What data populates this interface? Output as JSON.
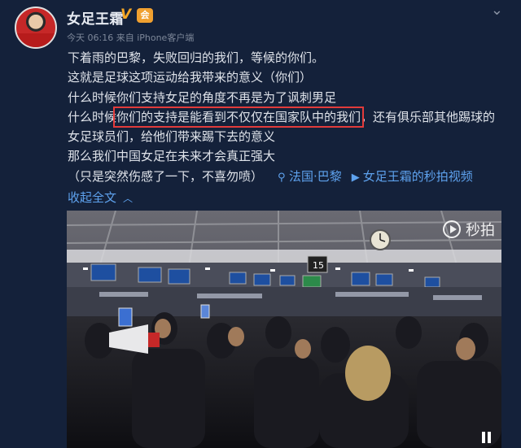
{
  "post": {
    "username": "女足王霜",
    "verified_badge": "V",
    "member_badge": "会",
    "meta": "今天 06:16 来自 iPhone客户端",
    "lines": [
      "下着雨的巴黎，失败回归的我们，等候的你们。",
      "这就是足球这项运动给我带来的意义（你们）",
      "什么时候你们支持女足的角度不再是为了讽刺男足"
    ],
    "line4_pre": "什么时候",
    "line4_highlight": "你们的支持是能看到不仅仅在国家队中的我们",
    "line4_post": "，还有俱乐部其他踢球的",
    "line5": "女足球员们，给他们带来踢下去的意义",
    "line6": "那么我们中国女足在未来才会真正强大",
    "line7_text": "（只是突然伤感了一下，不喜勿喷）",
    "location_icon": "location-pin-icon",
    "location": "法国·巴黎",
    "video_icon": "video-icon",
    "video_link": "女足王霜的秒拍视频",
    "collapse_label": "收起全文",
    "collapse_icon": "chevron-up-icon",
    "top_icon": "chevron-down-icon"
  },
  "video": {
    "watermark": "秒拍",
    "signs": [
      "15"
    ],
    "play_icon": "pause-icon"
  },
  "colors": {
    "background": "#14213a",
    "link": "#5ea2ee",
    "highlight_box": "#e23b3b",
    "verified": "#f5a623"
  }
}
